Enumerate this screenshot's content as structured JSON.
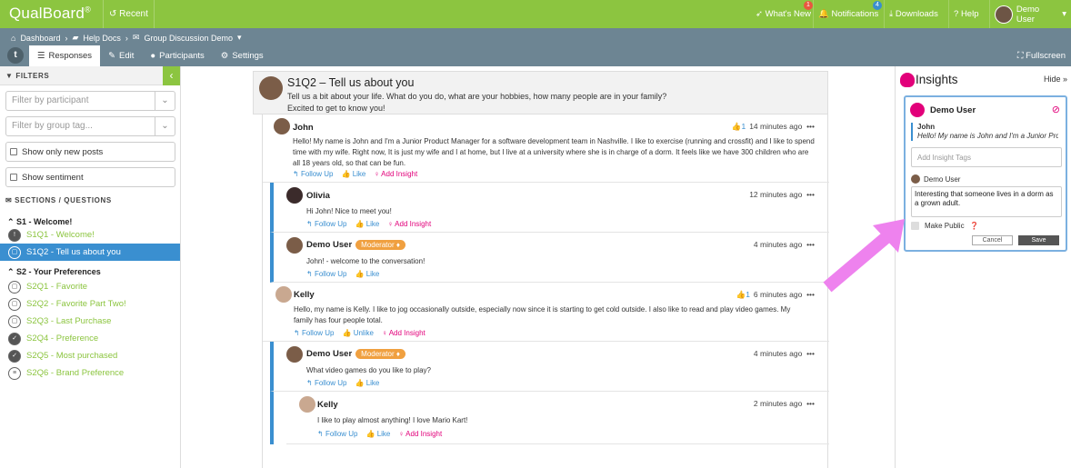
{
  "topbar": {
    "logo": "QualBoard",
    "logo_reg": "®",
    "recent": "Recent",
    "whats_new": "What's New",
    "whats_new_badge": "1",
    "notifications": "Notifications",
    "notifications_badge": "4",
    "downloads": "Downloads",
    "help": "Help",
    "user": "Demo User"
  },
  "breadcrumb": {
    "dashboard": "Dashboard",
    "help_docs": "Help Docs",
    "discussion": "Group Discussion Demo"
  },
  "tabs": {
    "logo": "t",
    "responses": "Responses",
    "edit": "Edit",
    "participants": "Participants",
    "settings": "Settings",
    "fullscreen": "Fullscreen"
  },
  "filters": {
    "title": "FILTERS",
    "participant_placeholder": "Filter by participant",
    "group_placeholder": "Filter by group tag...",
    "only_new": "Show only new posts",
    "sentiment": "Show sentiment"
  },
  "sections": {
    "title": "SECTIONS / QUESTIONS",
    "s1": {
      "label": "S1 - Welcome!",
      "items": [
        {
          "label": "S1Q1 - Welcome!"
        },
        {
          "label": "S1Q2 - Tell us about you"
        }
      ]
    },
    "s2": {
      "label": "S2 - Your Preferences",
      "items": [
        {
          "label": "S2Q1 - Favorite"
        },
        {
          "label": "S2Q2 - Favorite Part Two!"
        },
        {
          "label": "S2Q3 - Last Purchase"
        },
        {
          "label": "S2Q4 - Preference"
        },
        {
          "label": "S2Q5 - Most purchased"
        },
        {
          "label": "S2Q6 - Brand Preference"
        }
      ]
    }
  },
  "question": {
    "title": "S1Q2 – Tell us about you",
    "line1": "Tell us a bit about your life. What do you do, what are your hobbies, how many people are in your family?",
    "line2": "Excited to get to know you!"
  },
  "actions": {
    "follow": "Follow Up",
    "like": "Like",
    "unlike": "Unlike",
    "insight": "Add Insight",
    "more": "•••",
    "moderator": "Moderator"
  },
  "posts": [
    {
      "name": "John",
      "likes": "1",
      "time": "14 minutes ago",
      "text": "Hello! My name is John and I'm a Junior Product Manager for a software development team in Nashville. I like to exercise (running and crossfit) and I like to spend time with my wife. Right now, It is just my wife and I at home, but I live at a university where she is in charge of a dorm. It feels like we have 300 children who are all 18 years old, so that can be fun."
    },
    {
      "name": "Olivia",
      "time": "12 minutes ago",
      "text": "Hi John! Nice to meet you!"
    },
    {
      "name": "Demo User",
      "time": "4 minutes ago",
      "text": "John! - welcome to the conversation!"
    },
    {
      "name": "Kelly",
      "likes": "1",
      "time": "6 minutes ago",
      "text": "Hello, my name is Kelly. I like to jog occasionally outside, especially now since it is starting to get cold outside. I also like to read and play video games. My family has four people total."
    },
    {
      "name": "Demo User",
      "time": "4 minutes ago",
      "text": "What video games do you like to play?"
    },
    {
      "name": "Kelly",
      "time": "2 minutes ago",
      "text": "I like to play almost anything! I love Mario Kart!"
    }
  ],
  "insights": {
    "title": "Insights",
    "hide": "Hide",
    "card_user": "Demo User",
    "quote_name": "John",
    "quote_text": "Hello! My name is John and I'm a Junior Prod...",
    "tags_placeholder": "Add Insight Tags",
    "comment_user": "Demo User",
    "comment_text": "Interesting that someone lives in a dorm as a grown adult.",
    "make_public": "Make Public",
    "cancel": "Cancel",
    "save": "Save"
  },
  "colors": {
    "brand_green": "#8cc540",
    "subbar": "#6d8593",
    "accent_blue": "#3a8fd0",
    "insight_pink": "#e2007a",
    "moderator_orange": "#f0a040",
    "arrow_magenta": "#ee82ee"
  }
}
